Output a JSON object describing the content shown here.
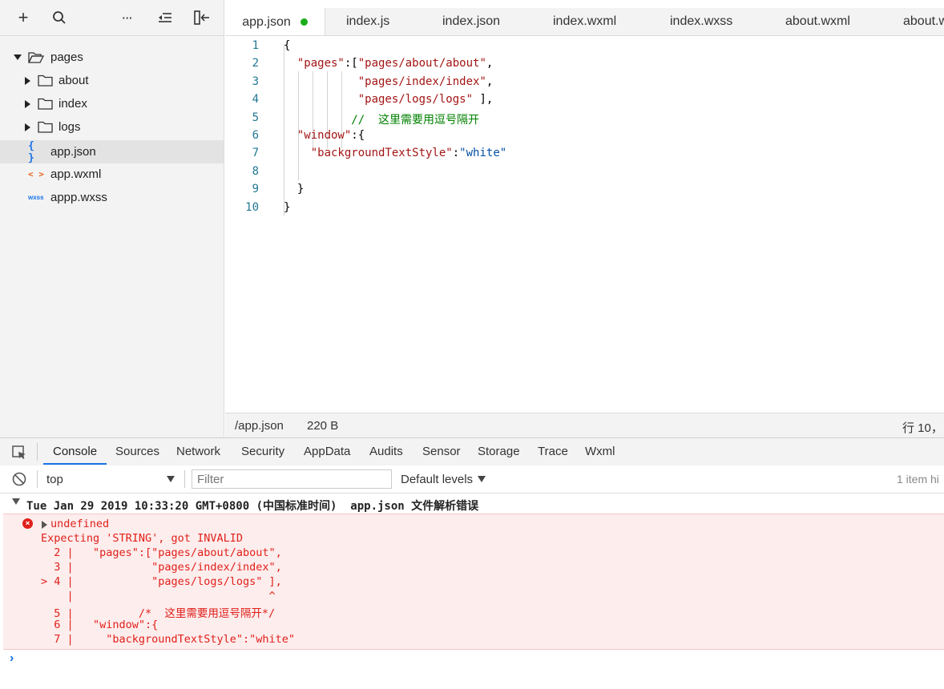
{
  "sidebar": {
    "toolbar": {
      "add": "+",
      "more": "···"
    },
    "tree": [
      {
        "label": "pages",
        "type": "folder-open"
      },
      {
        "label": "about",
        "type": "folder"
      },
      {
        "label": "index",
        "type": "folder"
      },
      {
        "label": "logs",
        "type": "folder"
      },
      {
        "label": "app.json",
        "type": "json",
        "icon": "{ }"
      },
      {
        "label": "app.wxml",
        "type": "wxml",
        "icon": "< >"
      },
      {
        "label": "appp.wxss",
        "type": "wxss",
        "icon": "wxss"
      }
    ]
  },
  "editor": {
    "tabs": [
      {
        "label": "app.json",
        "active": true,
        "modified": true
      },
      {
        "label": "index.js"
      },
      {
        "label": "index.json"
      },
      {
        "label": "index.wxml"
      },
      {
        "label": "index.wxss"
      },
      {
        "label": "about.wxml"
      },
      {
        "label": "about.w"
      }
    ],
    "lines": [
      {
        "n": "1",
        "p": [
          [
            "p",
            "{"
          ]
        ]
      },
      {
        "n": "2",
        "p": [
          [
            "p",
            "  "
          ],
          [
            "s",
            "\"pages\""
          ],
          [
            "p",
            ":["
          ],
          [
            "s",
            "\"pages/about/about\""
          ],
          [
            "p",
            ","
          ]
        ]
      },
      {
        "n": "3",
        "p": [
          [
            "p",
            "           "
          ],
          [
            "s",
            "\"pages/index/index\""
          ],
          [
            "p",
            ","
          ]
        ]
      },
      {
        "n": "4",
        "p": [
          [
            "p",
            "           "
          ],
          [
            "s",
            "\"pages/logs/logs\""
          ],
          [
            "p",
            " ],"
          ]
        ]
      },
      {
        "n": "5",
        "p": [
          [
            "p",
            "          "
          ],
          [
            "c",
            "//  这里需要用逗号隔开"
          ]
        ]
      },
      {
        "n": "6",
        "p": [
          [
            "p",
            "  "
          ],
          [
            "s",
            "\"window\""
          ],
          [
            "p",
            ":{"
          ]
        ]
      },
      {
        "n": "7",
        "p": [
          [
            "p",
            "    "
          ],
          [
            "s",
            "\"backgroundTextStyle\""
          ],
          [
            "p",
            ":"
          ],
          [
            "v",
            "\"white\""
          ]
        ]
      },
      {
        "n": "8",
        "p": [
          [
            "p",
            ""
          ]
        ]
      },
      {
        "n": "9",
        "p": [
          [
            "p",
            "  }"
          ]
        ]
      },
      {
        "n": "10",
        "p": [
          [
            "p",
            "}"
          ]
        ]
      }
    ],
    "status": {
      "path": "/app.json",
      "size": "220 B",
      "position": "行 10，"
    }
  },
  "devtools": {
    "tabs": [
      "Console",
      "Sources",
      "Network",
      "Security",
      "AppData",
      "Audits",
      "Sensor",
      "Storage",
      "Trace",
      "Wxml"
    ],
    "active_tab": "Console",
    "context": "top",
    "filter_placeholder": "Filter",
    "levels": "Default levels",
    "hidden": "1 item hi",
    "log": {
      "header": "Tue Jan 29 2019 10:33:20 GMT+0800 (中国标准时间)  app.json 文件解析错误",
      "undefined": "undefined",
      "lines": [
        "Expecting 'STRING', got INVALID",
        "  2 |   \"pages\":[\"pages/about/about\",",
        "  3 |            \"pages/index/index\",",
        "> 4 |            \"pages/logs/logs\" ],",
        "    |                              ^",
        "  5 |          /*  这里需要用逗号隔开*/",
        "  6 |   \"window\":{",
        "  7 |     \"backgroundTextStyle\":\"white\""
      ]
    },
    "prompt": "›"
  },
  "colors": {
    "accent": "#1a73e8",
    "modified": "#1aad19",
    "error": "#e0201a",
    "error_bg": "#fdeded"
  }
}
